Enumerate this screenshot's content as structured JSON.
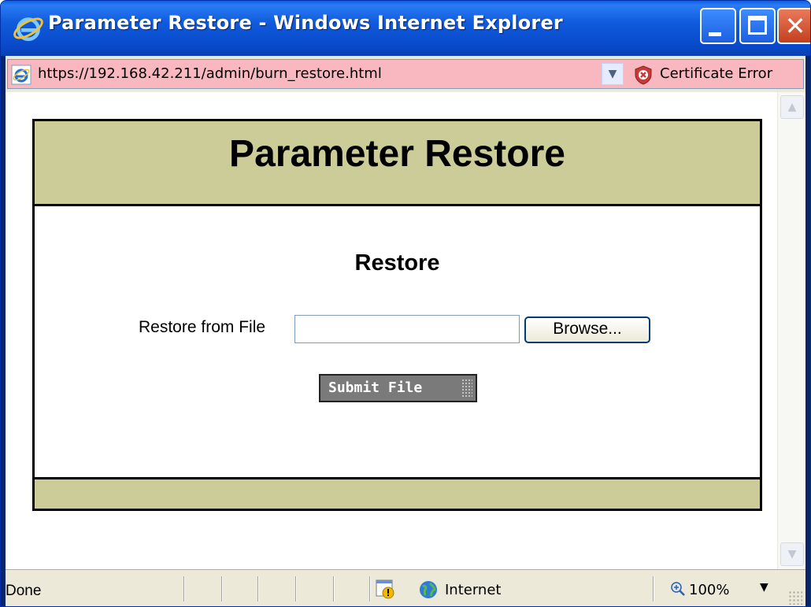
{
  "window": {
    "title": "Parameter Restore - Windows Internet Explorer",
    "controls": {
      "minimize": "minimize",
      "maximize": "maximize",
      "close": "✕"
    }
  },
  "address": {
    "url": "https://192.168.42.211/admin/burn_restore.html",
    "certificate_text": "Certificate Error",
    "bar_color": "#f9b8c0"
  },
  "page": {
    "title": "Parameter Restore",
    "section_title": "Restore",
    "file_label": "Restore from File",
    "file_value": "",
    "browse_label": "Browse...",
    "submit_label": "Submit File",
    "header_color": "#cccc99"
  },
  "status": {
    "text": "Done",
    "zone": "Internet",
    "zoom": "100%"
  },
  "icons": {
    "title_icon": "ie-logo-icon",
    "address_icon": "ie-page-icon",
    "certificate_icon": "certificate-error-shield-icon",
    "alert_icon": "security-alert-icon",
    "zone_icon": "internet-globe-icon",
    "zoom_icon": "zoom-magnifier-icon"
  }
}
